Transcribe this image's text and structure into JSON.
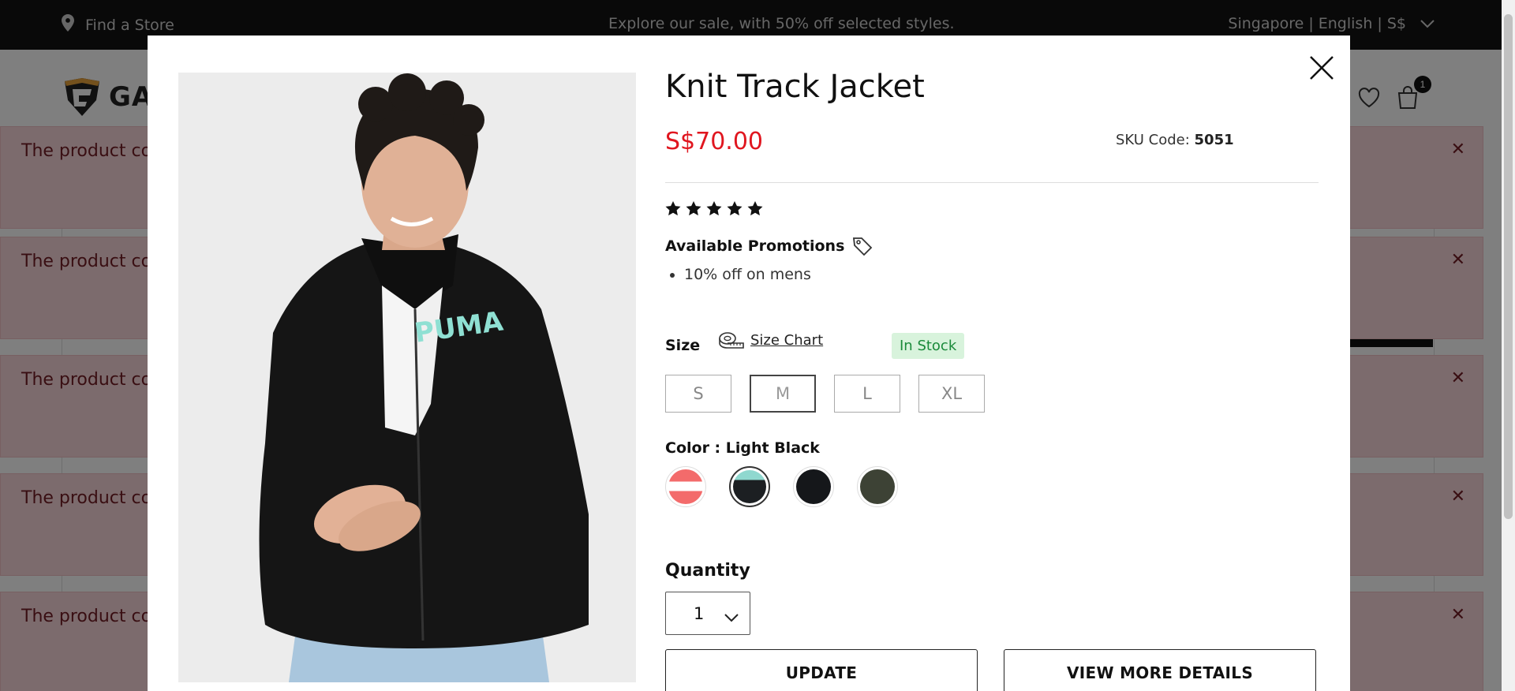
{
  "topbar": {
    "find_store": "Find a Store",
    "promo": "Explore our sale, with 50% off selected styles.",
    "locale": "Singapore | English | S$"
  },
  "header": {
    "logo_text": "GAU",
    "cart_count": "1"
  },
  "toasts": [
    {
      "message": "The product cou"
    },
    {
      "message": "The product cou"
    },
    {
      "message": "The product cou"
    },
    {
      "message": "The product cou"
    },
    {
      "message": "The product cou"
    }
  ],
  "modal": {
    "title": "Knit Track Jacket",
    "price": "S$70.00",
    "sku_label": "SKU Code:",
    "sku_value": "5051",
    "rating": 5,
    "promotions_heading": "Available Promotions",
    "promotions": [
      "10% off on mens"
    ],
    "size_label": "Size",
    "size_chart_label": "Size Chart",
    "stock_status": "In Stock",
    "sizes": [
      "S",
      "M",
      "L",
      "XL"
    ],
    "selected_size": "M",
    "color_label": "Color : Light Black",
    "colors": [
      {
        "name": "red-white",
        "hex": "#f36b6b"
      },
      {
        "name": "light-black",
        "hex": "#1c1f22"
      },
      {
        "name": "black",
        "hex": "#15171a"
      },
      {
        "name": "olive",
        "hex": "#3d4235"
      }
    ],
    "quantity_label": "Quantity",
    "quantity_value": "1",
    "update_label": "UPDATE",
    "details_label": "VIEW MORE DETAILS"
  },
  "colors": {
    "price_red": "#e0161f",
    "stock_green": "#1a8a3a",
    "toast_bg": "#f8d7da",
    "toast_text": "#721c24"
  }
}
